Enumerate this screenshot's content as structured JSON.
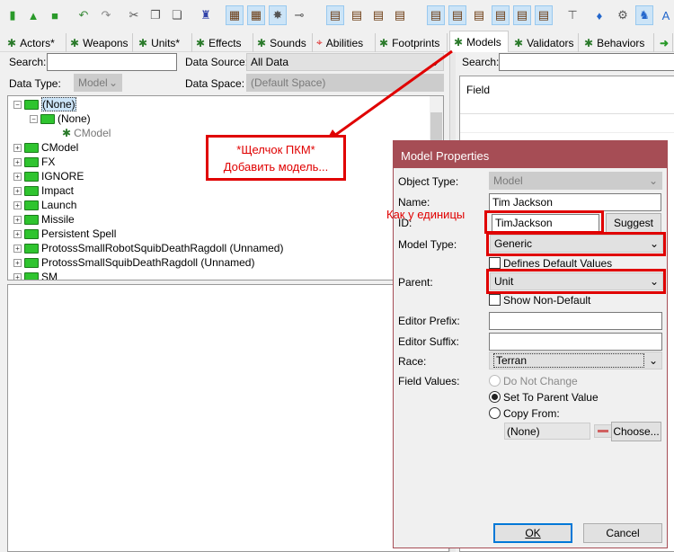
{
  "toolbar": {
    "icons": [
      "new-icon",
      "open-icon",
      "save-icon",
      "undo-icon",
      "redo-icon",
      "cut-icon",
      "copy-icon",
      "paste-icon",
      "data-icon",
      "table-icon",
      "table-icon",
      "effect-icon",
      "connect-icon",
      "module-icon",
      "module-icon",
      "module-icon",
      "module-icon",
      "module-icon",
      "module-icon",
      "module-icon",
      "module-icon",
      "module-icon",
      "module-icon",
      "tool-icon",
      "water-icon",
      "gear-icon",
      "unit-icon",
      "text-icon"
    ]
  },
  "tabs": [
    {
      "label": "Actors*"
    },
    {
      "label": "Weapons"
    },
    {
      "label": "Units*"
    },
    {
      "label": "Effects"
    },
    {
      "label": "Sounds"
    },
    {
      "label": "Abilities"
    },
    {
      "label": "Footprints"
    },
    {
      "label": "Models",
      "active": true
    },
    {
      "label": "Validators"
    },
    {
      "label": "Behaviors"
    }
  ],
  "left": {
    "search_label": "Search:",
    "search_value": "",
    "data_source_label": "Data Source:",
    "data_source": "All Data",
    "data_type_label": "Data Type:",
    "data_type": "Model",
    "data_space_label": "Data Space:",
    "data_space": "(Default Space)"
  },
  "tree": [
    "(None)",
    "(None)",
    "CModel",
    "CModel",
    "FX",
    "IGNORE",
    "Impact",
    "Launch",
    "Missile",
    "Persistent Spell",
    "ProtossSmallRobotSquibDeathRagdoll (Unnamed)",
    "ProtossSmallSquibDeathRagdoll (Unnamed)",
    "SM"
  ],
  "right": {
    "search_label": "Search:",
    "column_header": "Field"
  },
  "annotation": {
    "line1": "*Щелчок ПКМ*",
    "line2": "Добавить модель...",
    "id_note": "Как у единицы",
    "color": "#e00000"
  },
  "dialog": {
    "title": "Model Properties",
    "object_type_label": "Object Type:",
    "object_type": "Model",
    "name_label": "Name:",
    "name": "Tim Jackson",
    "id_label": "ID:",
    "id": "TimJackson",
    "suggest": "Suggest",
    "model_type_label": "Model Type:",
    "model_type": "Generic",
    "defines_default": "Defines Default Values",
    "parent_label": "Parent:",
    "parent": "Unit",
    "show_non_default": "Show Non-Default",
    "prefix_label": "Editor Prefix:",
    "prefix": "",
    "suffix_label": "Editor Suffix:",
    "suffix": "",
    "race_label": "Race:",
    "race": "Terran",
    "field_values_label": "Field Values:",
    "opt_no_change": "Do Not Change",
    "opt_parent": "Set To Parent Value",
    "opt_copy": "Copy From:",
    "copy_value": "(None)",
    "choose": "Choose...",
    "ok": "OK",
    "cancel": "Cancel",
    "title_color": "#a64d55"
  }
}
